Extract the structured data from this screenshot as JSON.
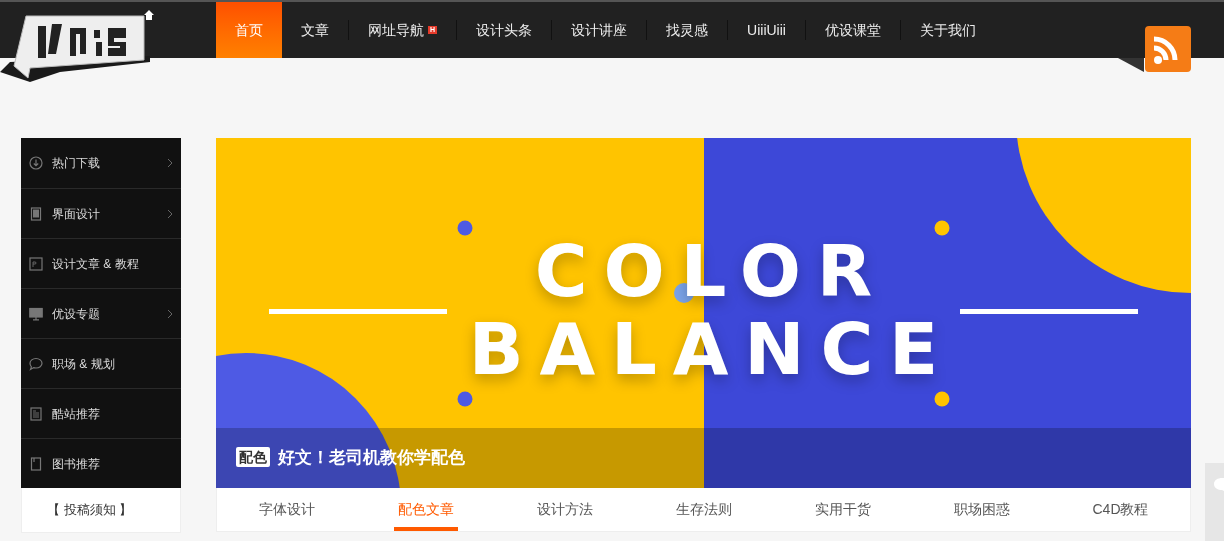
{
  "nav": [
    {
      "label": "首页",
      "selected": true,
      "hot": false
    },
    {
      "label": "文章",
      "selected": false,
      "hot": false
    },
    {
      "label": "网址导航",
      "selected": false,
      "hot": true
    },
    {
      "label": "设计头条",
      "selected": false,
      "hot": false
    },
    {
      "label": "设计讲座",
      "selected": false,
      "hot": false
    },
    {
      "label": "找灵感",
      "selected": false,
      "hot": false
    },
    {
      "label": "UiiiUiii",
      "selected": false,
      "hot": false
    },
    {
      "label": "优设课堂",
      "selected": false,
      "hot": false
    },
    {
      "label": "关于我们",
      "selected": false,
      "hot": false
    }
  ],
  "hot_badge": "H",
  "sidebar": {
    "items": [
      {
        "label": "热门下载",
        "kind": "download",
        "has_arrow": true
      },
      {
        "label": "界面设计",
        "kind": "tablet",
        "has_arrow": true
      },
      {
        "label": "设计文章 & 教程",
        "kind": "ps",
        "has_arrow": false
      },
      {
        "label": "优设专题",
        "kind": "monitor",
        "has_arrow": true
      },
      {
        "label": "职场 & 规划",
        "kind": "chat",
        "has_arrow": false
      },
      {
        "label": "酷站推荐",
        "kind": "page",
        "has_arrow": false
      },
      {
        "label": "图书推荐",
        "kind": "book",
        "has_arrow": false
      }
    ],
    "footer_link": "【 投稿须知 】"
  },
  "banner": {
    "headline": [
      "COLOR",
      "BALANCE"
    ],
    "tag": "配色",
    "caption": "好文！老司机教你学配色"
  },
  "tabs": [
    {
      "label": "字体设计",
      "selected": false
    },
    {
      "label": "配色文章",
      "selected": true
    },
    {
      "label": "设计方法",
      "selected": false
    },
    {
      "label": "生存法则",
      "selected": false
    },
    {
      "label": "实用干货",
      "selected": false
    },
    {
      "label": "职场困惑",
      "selected": false
    },
    {
      "label": "C4D教程",
      "selected": false
    }
  ]
}
